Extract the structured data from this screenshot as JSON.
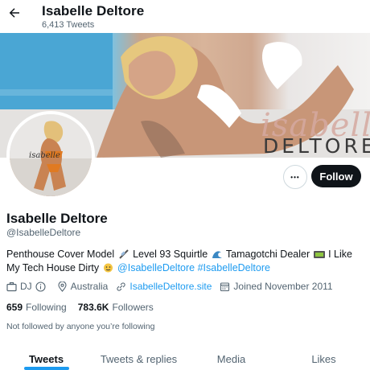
{
  "header": {
    "back_icon": "arrow-left-icon",
    "name": "Isabelle Deltore",
    "tweet_count": "6,413 Tweets"
  },
  "banner": {
    "script_text": "isabelle",
    "brand_text": "DELTORE"
  },
  "avatar": {
    "brand_text": "isabelle"
  },
  "actions": {
    "more_label": "•••",
    "follow_label": "Follow"
  },
  "profile": {
    "display_name": "Isabelle Deltore",
    "handle": "@IsabelleDeltore",
    "bio": {
      "part1": "Penthouse Cover Model ",
      "part2": " Level 93 Squirtle ",
      "part3": " Tamagotchi Dealer ",
      "part4": " I Like My Tech House Dirty ",
      "mention": "@IsabelleDeltore",
      "hashtag": "#IsabelleDeltore"
    },
    "meta": {
      "category": "DJ",
      "location": "Australia",
      "website": "IsabelleDeltore.site",
      "joined": "Joined November 2011"
    },
    "following_count": "659",
    "following_label": "Following",
    "followers_count": "783.6K",
    "followers_label": "Followers",
    "not_followed": "Not followed by anyone you’re following"
  },
  "tabs": [
    {
      "label": "Tweets",
      "active": true
    },
    {
      "label": "Tweets & replies",
      "active": false
    },
    {
      "label": "Media",
      "active": false
    },
    {
      "label": "Likes",
      "active": false
    }
  ],
  "colors": {
    "accent": "#1d9bf0",
    "text": "#0f1419",
    "secondary": "#536471"
  }
}
